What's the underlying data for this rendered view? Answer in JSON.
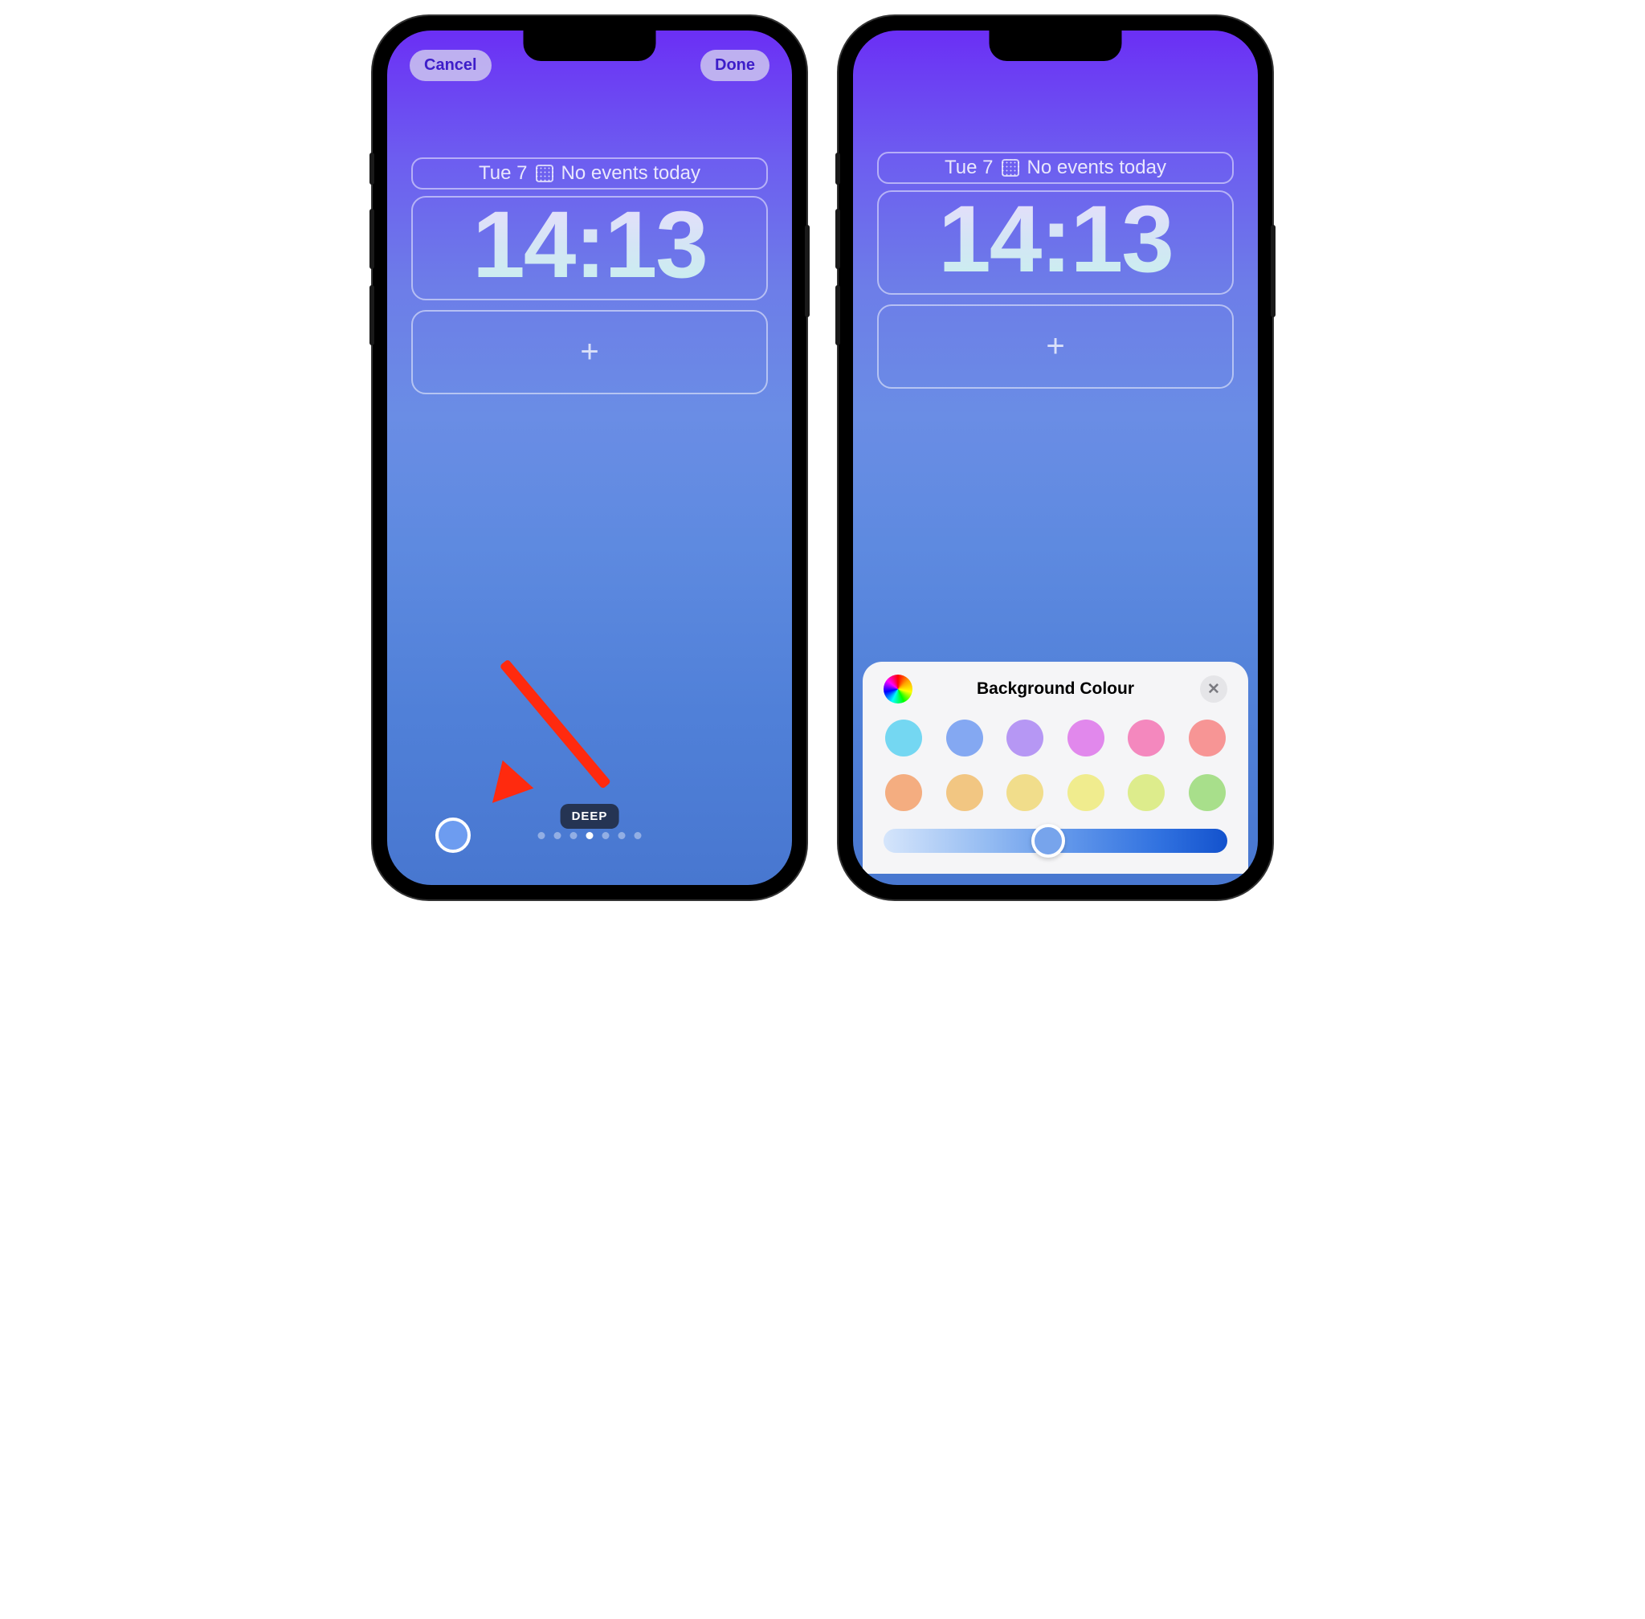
{
  "phone1": {
    "cancel_label": "Cancel",
    "done_label": "Done",
    "date_text": "Tue 7",
    "events_text": "No events today",
    "time": "14:13",
    "style_label": "DEEP",
    "page_dots": {
      "count": 7,
      "active_index": 3
    },
    "color_circle": "#6d9cf0"
  },
  "phone2": {
    "date_text": "Tue 7",
    "events_text": "No events today",
    "time": "14:13",
    "sheet": {
      "title": "Background Colour",
      "swatches_row1": [
        "#74d7f2",
        "#84a8f2",
        "#b697f4",
        "#e188ec",
        "#f488be",
        "#f79595"
      ],
      "swatches_row2": [
        "#f4ad80",
        "#f2c682",
        "#f1dd8b",
        "#f0ec8e",
        "#ddec8c",
        "#a8df8b"
      ],
      "slider_value": 0.48
    }
  },
  "annotation": {
    "arrow_color": "#ff2a0e"
  }
}
